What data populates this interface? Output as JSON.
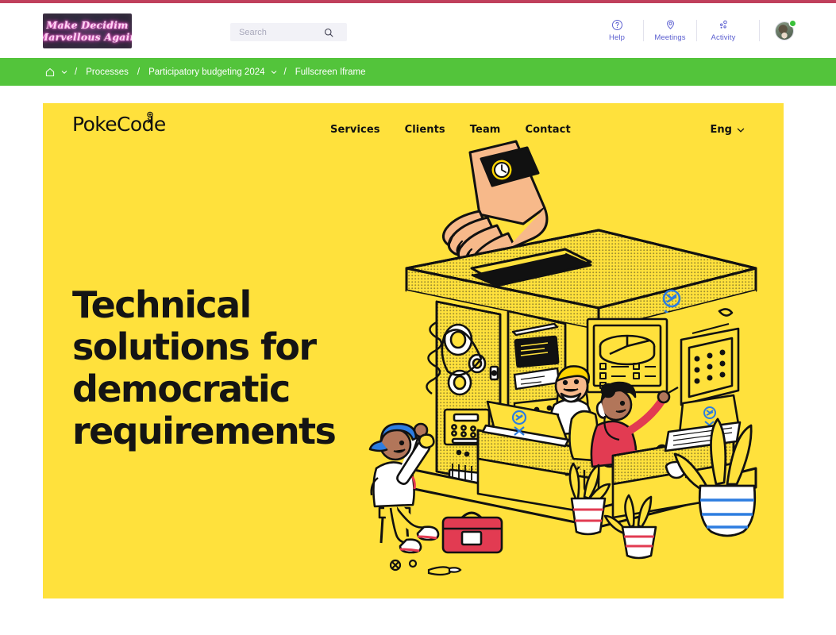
{
  "theme": {
    "accent_strip": "#c0405c",
    "breadcrumb_green": "#53c43b",
    "header_link_blue": "#5b5fd0",
    "iframe_yellow": "#ffe13c",
    "status_online": "#3ac13a"
  },
  "header": {
    "logo": {
      "name": "Make Decidim Marvellous Again",
      "line1": "Make Decidim",
      "line2": "Marvellous Again"
    },
    "search": {
      "placeholder": "Search",
      "value": "",
      "icon": "search-icon"
    },
    "nav": [
      {
        "label": "Help",
        "icon": "question-circle-icon"
      },
      {
        "label": "Meetings",
        "icon": "map-pin-icon"
      },
      {
        "label": "Activity",
        "icon": "activity-dots-icon"
      }
    ],
    "account": {
      "avatar": "avatar",
      "status": "online"
    }
  },
  "breadcrumb": {
    "home_icon": "home-icon",
    "home_chevron_icon": "chevron-down-icon",
    "separator": "/",
    "items": [
      {
        "label": "Processes",
        "has_chevron": false
      },
      {
        "label": "Participatory budgeting 2024",
        "has_chevron": true
      },
      {
        "label": "Fullscreen Iframe",
        "has_chevron": false
      }
    ]
  },
  "iframe": {
    "site": {
      "logo_text": "PokeCode",
      "logo_mark": "pokecode-mark-icon",
      "nav": [
        {
          "label": "Services"
        },
        {
          "label": "Clients"
        },
        {
          "label": "Team"
        },
        {
          "label": "Contact"
        }
      ],
      "language": {
        "label": "Eng",
        "chevron_icon": "chevron-down-icon"
      },
      "hero": {
        "title": "Technical\nsolutions for\ndemocratic\nrequirements",
        "illustration": "ballot-box-office-illustration"
      }
    }
  }
}
